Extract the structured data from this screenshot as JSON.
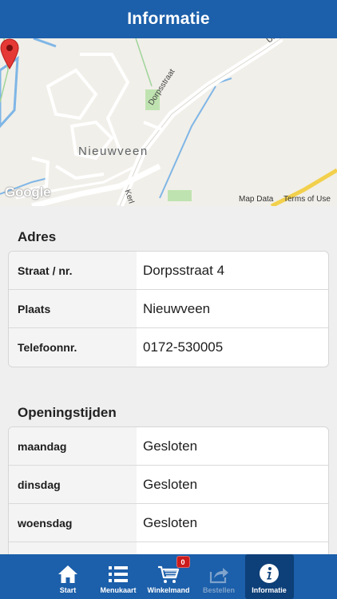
{
  "header": {
    "title": "Informatie"
  },
  "map": {
    "town_label": "Nieuwveen",
    "street_main": "Dorpsstraat",
    "street_side": "Kerl",
    "street_top": "Ui",
    "google_label": "Google",
    "map_data_label": "Map Data",
    "terms_label": "Terms of Use"
  },
  "address": {
    "section_title": "Adres",
    "rows": [
      {
        "label": "Straat / nr.",
        "value": "Dorpsstraat 4"
      },
      {
        "label": "Plaats",
        "value": "Nieuwveen"
      },
      {
        "label": "Telefoonnr.",
        "value": "0172-530005"
      }
    ]
  },
  "hours": {
    "section_title": "Openingstijden",
    "rows": [
      {
        "label": "maandag",
        "value": "Gesloten"
      },
      {
        "label": "dinsdag",
        "value": "Gesloten"
      },
      {
        "label": "woensdag",
        "value": "Gesloten"
      }
    ]
  },
  "tabbar": {
    "tabs": [
      {
        "label": "Start",
        "icon": "home-icon"
      },
      {
        "label": "Menukaart",
        "icon": "list-icon"
      },
      {
        "label": "Winkelmand",
        "icon": "cart-icon",
        "badge": "0"
      },
      {
        "label": "Bestellen",
        "icon": "share-icon"
      },
      {
        "label": "Informatie",
        "icon": "info-icon"
      }
    ]
  },
  "colors": {
    "primary": "#1c5faa",
    "active_tab": "#0d3f78",
    "badge": "#cc1b1b",
    "pin": "#e53935"
  }
}
